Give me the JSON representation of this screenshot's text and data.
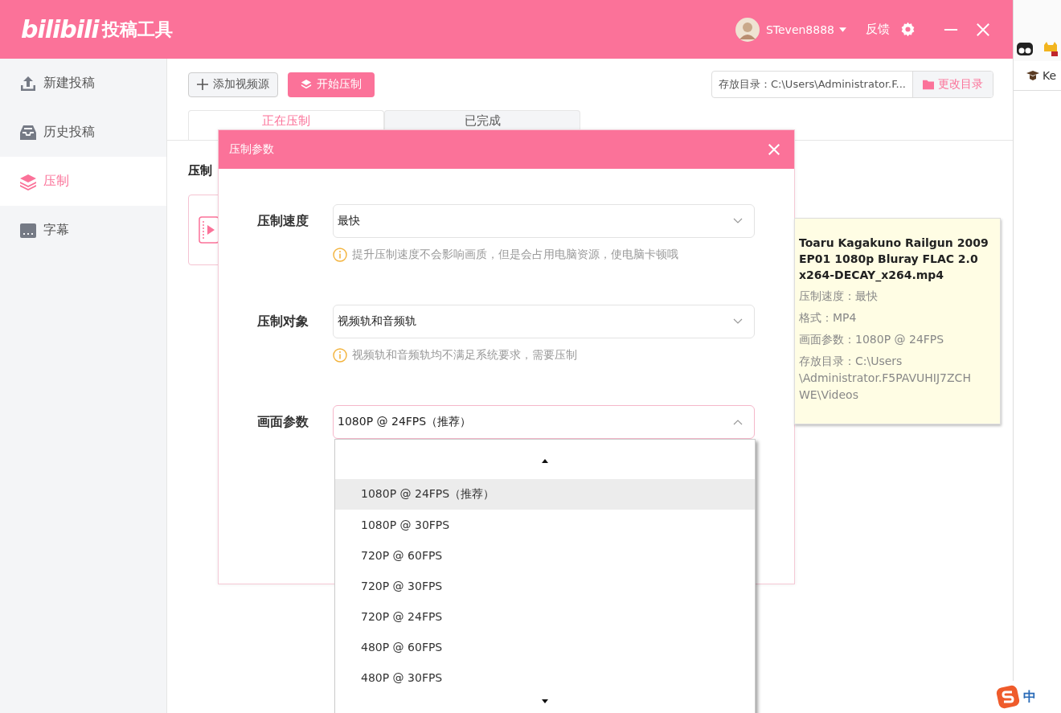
{
  "header": {
    "logo": "bilibili",
    "title": "投稿工具",
    "username": "STeven8888",
    "feedback": "反馈"
  },
  "sidebar": {
    "items": [
      {
        "label": "新建投稿",
        "selected": false
      },
      {
        "label": "历史投稿",
        "selected": false
      },
      {
        "label": "压制",
        "selected": true
      },
      {
        "label": "字幕",
        "selected": false
      }
    ]
  },
  "toolbar": {
    "add_button": "添加视频源",
    "start_button": "开始压制",
    "directory_field": "存放目录：C:\\Users\\Administrator.F...",
    "change_directory_button": "更改目录"
  },
  "tabs": [
    {
      "label": "正在压制",
      "selected": true
    },
    {
      "label": "已完成",
      "selected": false
    }
  ],
  "section_heading": "压制",
  "dialog": {
    "title": "压制参数",
    "fields": [
      {
        "label": "压制速度",
        "value": "最快",
        "expanded": false,
        "hint": "提升压制速度不会影响画质，但是会占用电脑资源，使电脑卡顿哦"
      },
      {
        "label": "压制对象",
        "value": "视频轨和音频轨",
        "expanded": false,
        "hint": "视频轨和音频轨均不满足系统要求，需要压制"
      },
      {
        "label": "画面参数",
        "value": "1080P @ 24FPS（推荐）",
        "expanded": true
      }
    ]
  },
  "dropdown": {
    "options": [
      {
        "label": "1080P @ 24FPS（推荐）",
        "selected": true
      },
      {
        "label": "1080P @ 30FPS",
        "selected": false
      },
      {
        "label": "720P @ 60FPS",
        "selected": false
      },
      {
        "label": "720P @ 30FPS",
        "selected": false
      },
      {
        "label": "720P @ 24FPS",
        "selected": false
      },
      {
        "label": "480P @ 60FPS",
        "selected": false
      },
      {
        "label": "480P @ 30FPS",
        "selected": false
      }
    ]
  },
  "tooltip": {
    "title": "Toaru Kagakuno Railgun 2009 EP01 1080p Bluray FLAC 2.0 x264-DECAY_x264.mp4",
    "lines": [
      "压制速度：最快",
      "格式：MP4",
      "画面参数：1080P @ 24FPS",
      "存放目录：C:\\Users \\Administrator.F5PAVUHIJ7ZCH WE\\Videos"
    ]
  },
  "side_window": {
    "bookmark": "Ke",
    "ime_mode": "中"
  }
}
